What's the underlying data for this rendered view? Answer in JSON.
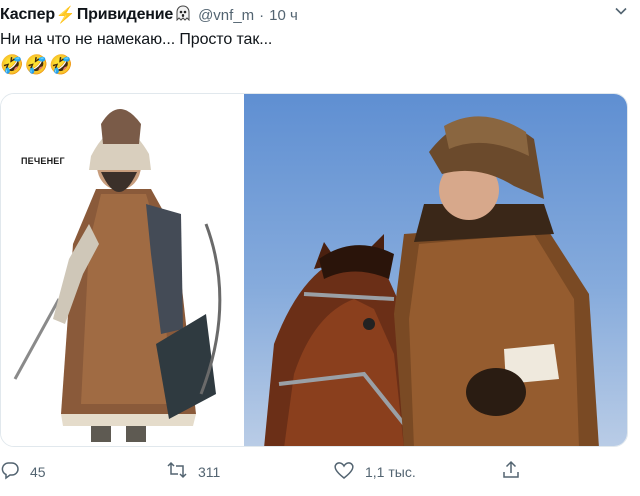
{
  "author": {
    "display_name": "Каспер",
    "display_name_suffix": "Привидение",
    "handle": "@vnf_m",
    "separator": "·",
    "time": "10 ч",
    "bolt_emoji": "⚡"
  },
  "tweet": {
    "text": "Ни на что не намекаю... Просто так...",
    "emojis": [
      "🤣",
      "🤣",
      "🤣"
    ]
  },
  "media": {
    "left_caption": "ПЕЧЕНЕГ"
  },
  "actions": {
    "replies": "45",
    "retweets": "311",
    "likes": "1,1 тыс."
  },
  "colors": {
    "text": "#0f1419",
    "muted": "#536471",
    "bolt": "#f5b400",
    "sky": "#6f9ad6"
  },
  "icons": [
    "ghost-icon",
    "chevron-down-icon",
    "reply-icon",
    "retweet-icon",
    "like-icon",
    "share-icon"
  ]
}
